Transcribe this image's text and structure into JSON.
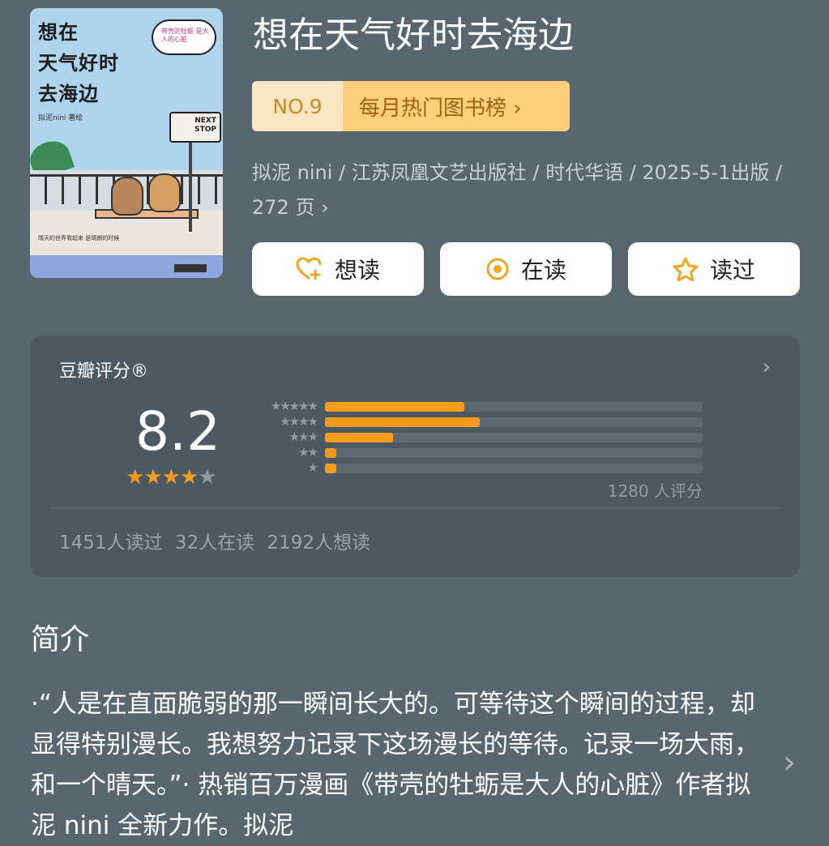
{
  "book": {
    "title": "想在天气好时去海边",
    "cover": {
      "title_lines": [
        "想在",
        "天气好时",
        "去海边"
      ],
      "cloud_text": "带壳的牡蛎 是大人的心脏",
      "sign_text": "NEXT STOP",
      "author_text": "拟泥nini 著绘",
      "small_text": "晴天的世界看起来 是晴朗的时候"
    },
    "rank": {
      "no": "NO.9",
      "label": "每月热门图书榜 ›"
    },
    "meta": "拟泥 nini / 江苏凤凰文艺出版社 / 时代华语 / 2025-5-1出版 / 272 页 ›",
    "actions": [
      {
        "label": "想读",
        "icon": "heart-plus-icon"
      },
      {
        "label": "在读",
        "icon": "target-icon"
      },
      {
        "label": "读过",
        "icon": "star-icon"
      }
    ]
  },
  "rating": {
    "label": "豆瓣评分®",
    "score": "8.2",
    "stars_filled": 4,
    "stars_total": 5,
    "distribution": [
      {
        "stars": 5,
        "fraction": 0.37
      },
      {
        "stars": 4,
        "fraction": 0.41
      },
      {
        "stars": 3,
        "fraction": 0.18
      },
      {
        "stars": 2,
        "fraction": 0.03
      },
      {
        "stars": 1,
        "fraction": 0.03
      }
    ],
    "count_text": "1280 人评分",
    "stats": "1451人读过  32人在读  2192人想读"
  },
  "intro": {
    "heading": "简介",
    "text": "·“人是在直面脆弱的那一瞬间长大的。可等待这个瞬间的过程，却显得特别漫长。我想努力记录下这场漫长的等待。记录一场大雨，和一个晴天。”· 热销百万漫画《带壳的牡蛎是大人的心脏》作者拟泥 nini 全新力作。拟泥"
  },
  "colors": {
    "accent": "#f79b1a",
    "background": "#58666f",
    "card": "#4c5962"
  }
}
